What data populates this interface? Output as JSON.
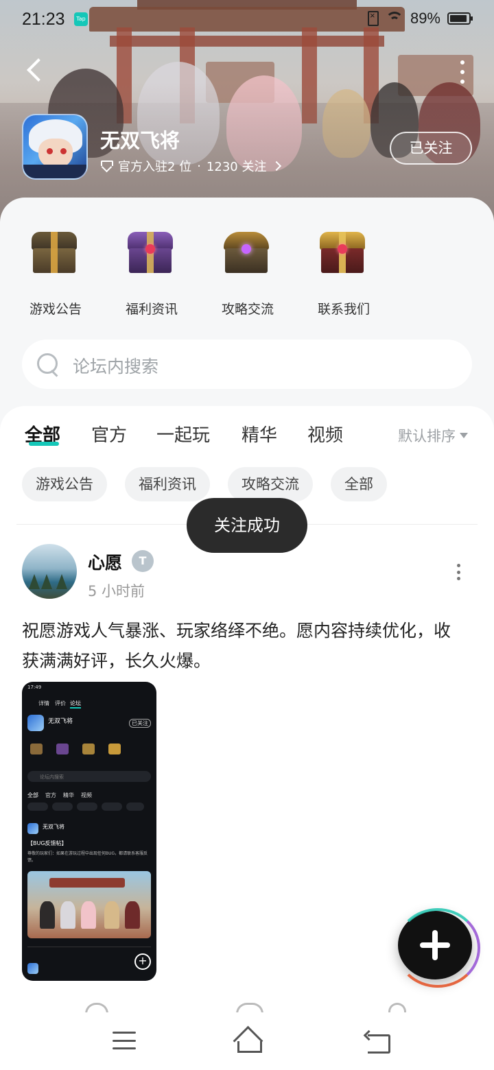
{
  "status_bar": {
    "time": "21:23",
    "app_badge": "Tap",
    "battery": "89%"
  },
  "header": {
    "game_title": "无双飞将",
    "official_label": "官方入驻2 位",
    "separator": "·",
    "followers": "1230 关注",
    "follow_button": "已关注"
  },
  "shortcuts": [
    {
      "label": "游戏公告",
      "icon": "golden-chest-icon"
    },
    {
      "label": "福利资讯",
      "icon": "purple-chest-icon"
    },
    {
      "label": "攻略交流",
      "icon": "ornate-chest-icon"
    },
    {
      "label": "联系我们",
      "icon": "gold-chest-icon"
    }
  ],
  "search": {
    "placeholder": "论坛内搜索"
  },
  "tabs": [
    "全部",
    "官方",
    "一起玩",
    "精华",
    "视频"
  ],
  "active_tab": "全部",
  "sort_label": "默认排序",
  "chips": [
    "游戏公告",
    "福利资讯",
    "攻略交流",
    "全部"
  ],
  "toast": "关注成功",
  "post": {
    "author": "心愿",
    "badge": "T",
    "time": "5 小时前",
    "body": "祝愿游戏人气暴涨、玩家络绎不绝。愿内容持续优化，收获满满好评，长久火爆。"
  },
  "thumbnail": {
    "time": "17:49",
    "tabs": [
      "详情",
      "评价",
      "论坛"
    ],
    "title": "无双飞将",
    "follow": "已关注",
    "search": "论坛内搜索",
    "feed_tabs": [
      "全部",
      "官方",
      "精华",
      "视频"
    ],
    "post_title": "【BUG反馈帖】",
    "post_text": "尊敬的玩家们：如果在游玩过程中出现任何BUG，都请联系客服反馈。"
  },
  "colors": {
    "accent": "#15c7b8",
    "toast_bg": "#2b2b2b",
    "sheet_bg": "#f6f7f8"
  }
}
